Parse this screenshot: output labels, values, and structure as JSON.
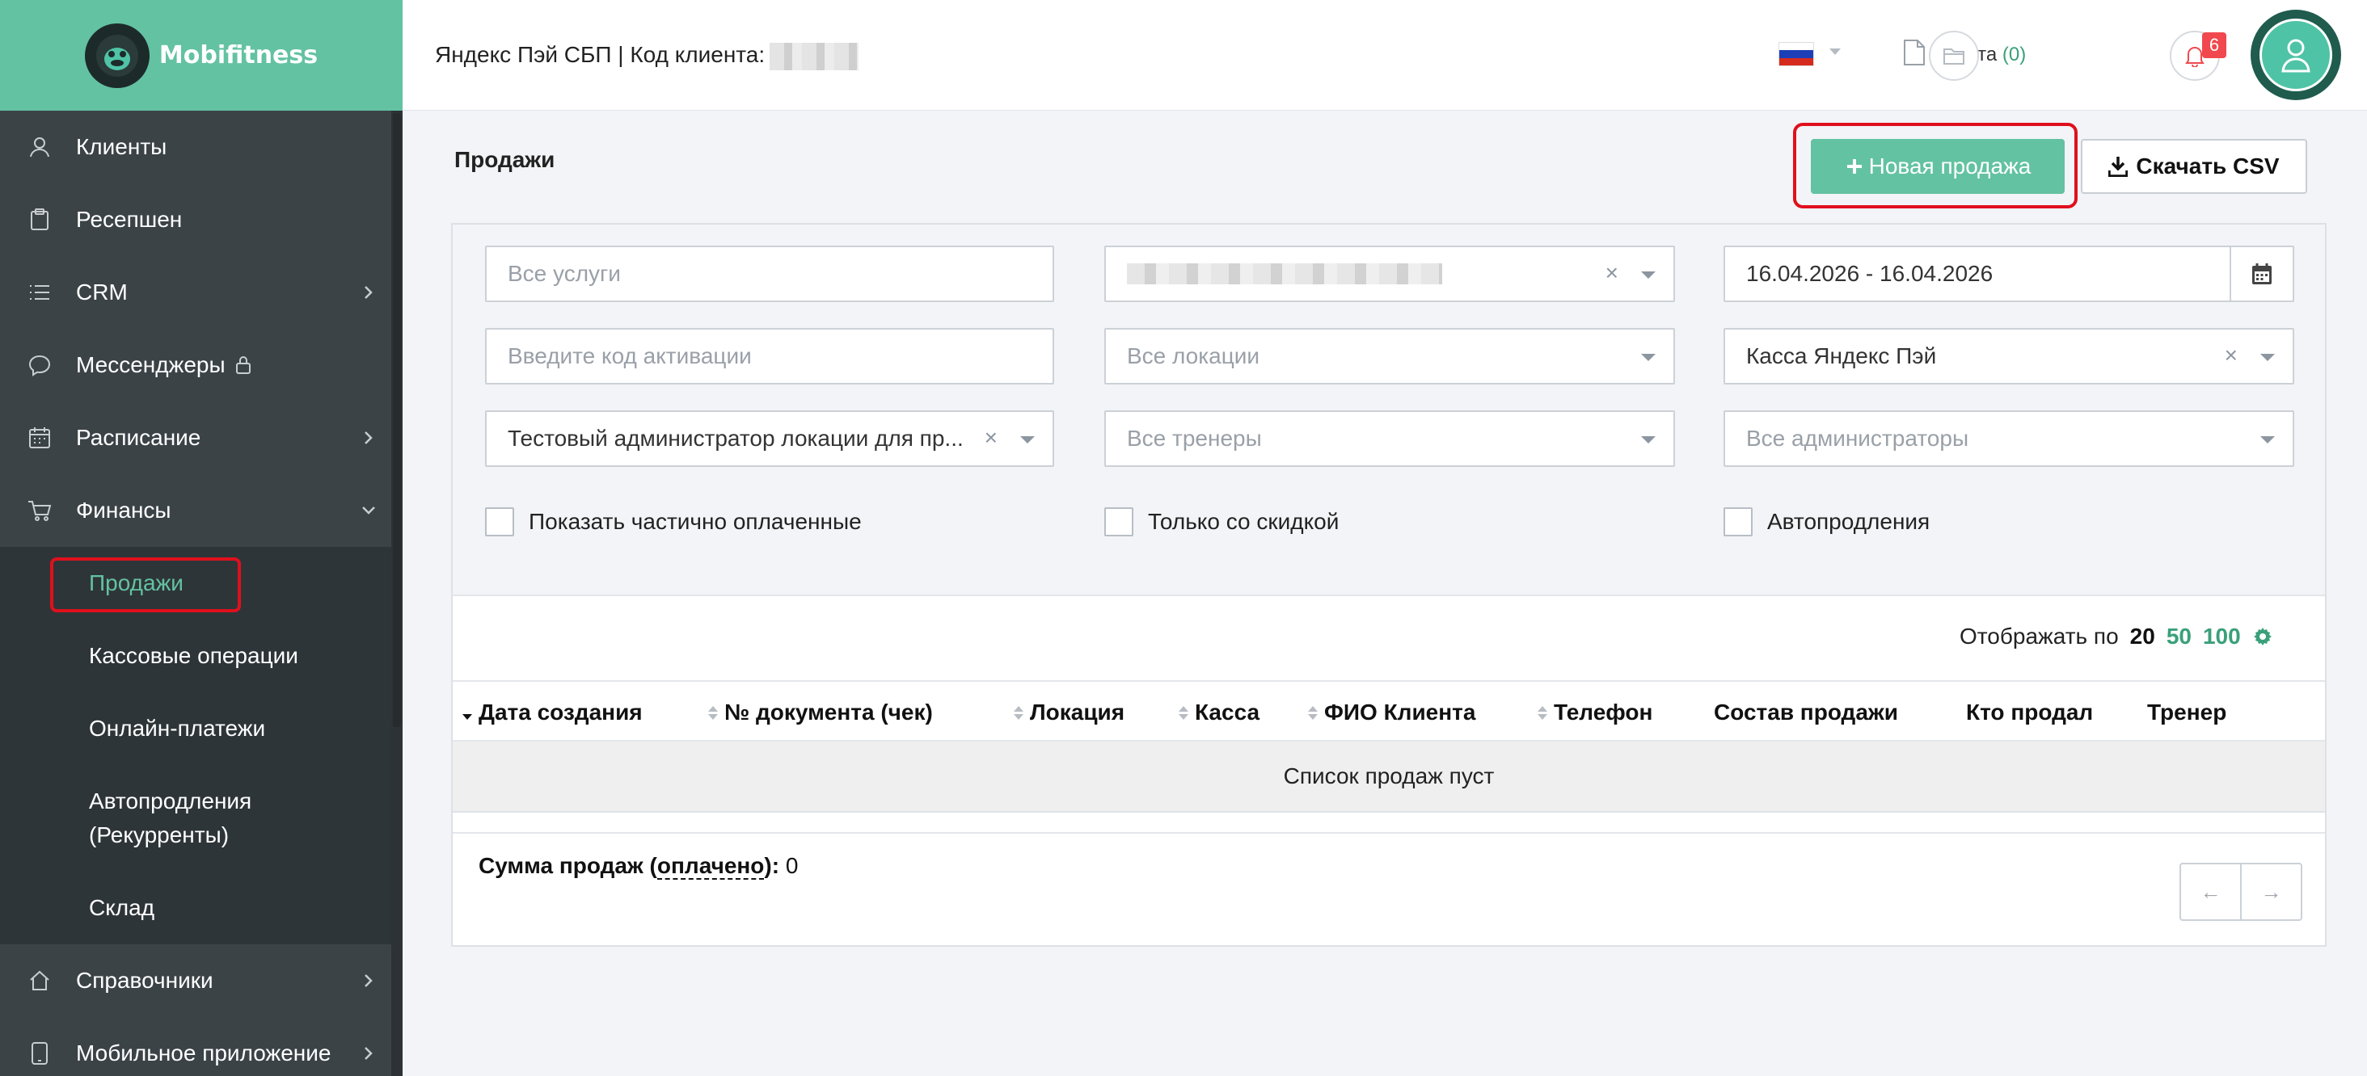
{
  "brand": {
    "name": "Mobifitness"
  },
  "sidebar": {
    "items": [
      {
        "label": "Клиенты",
        "icon": "user-icon"
      },
      {
        "label": "Ресепшен",
        "icon": "clipboard-icon"
      },
      {
        "label": "CRM",
        "icon": "list-icon",
        "has_arrow": true
      },
      {
        "label": "Мессенджеры",
        "icon": "chat-icon",
        "locked": true
      },
      {
        "label": "Расписание",
        "icon": "calendar-icon",
        "has_arrow": true
      },
      {
        "label": "Финансы",
        "icon": "cart-icon",
        "expanded": true
      }
    ],
    "finance_sub": [
      {
        "label": "Продажи",
        "active": true
      },
      {
        "label": "Кассовые операции"
      },
      {
        "label": "Онлайн-платежи"
      },
      {
        "label": "Автопродления (Рекурренты)"
      },
      {
        "label": "Склад"
      }
    ],
    "bottom_items": [
      {
        "label": "Справочники",
        "icon": "home-icon"
      },
      {
        "label": "Мобильное приложение",
        "icon": "phone-icon"
      }
    ]
  },
  "header": {
    "title": "Яндекс Пэй СБП | Код клиента:",
    "bills_label": "Счета",
    "bills_count": "(0)",
    "notifications_count": "6",
    "language": "ru-flag"
  },
  "page": {
    "title": "Продажи",
    "new_sale_label": "Новая продажа",
    "csv_label": "Скачать CSV"
  },
  "filters": {
    "services_placeholder": "Все услуги",
    "activation_placeholder": "Введите код активации",
    "admin_location_value": "Тестовый администратор локации для пр...",
    "locations_placeholder": "Все локации",
    "trainers_placeholder": "Все тренеры",
    "date_range": "16.04.2026 - 16.04.2026",
    "cashbox_value": "Касса Яндекс Пэй",
    "admins_placeholder": "Все администраторы",
    "clear_symbol": "×",
    "check_partial": "Показать частично оплаченные",
    "check_discount": "Только со скидкой",
    "check_autorenew": "Автопродления"
  },
  "table": {
    "per_page_label": "Отображать по",
    "per_page_current": "20",
    "per_page_options": [
      "50",
      "100"
    ],
    "columns": [
      "Дата создания",
      "№ документа (чек)",
      "Локация",
      "Касса",
      "ФИО Клиента",
      "Телефон",
      "Состав продажи",
      "Кто продал",
      "Тренер"
    ],
    "empty_text": "Список продаж пуст",
    "sum_prefix": "Сумма продаж (",
    "sum_paid": "оплачено",
    "sum_suffix": "): ",
    "sum_value": "0",
    "prev": "←",
    "next": "→"
  },
  "colors": {
    "accent": "#63c2a1",
    "sidebar": "#3b4347",
    "highlight": "#e0101d",
    "badge": "#f0484e"
  }
}
